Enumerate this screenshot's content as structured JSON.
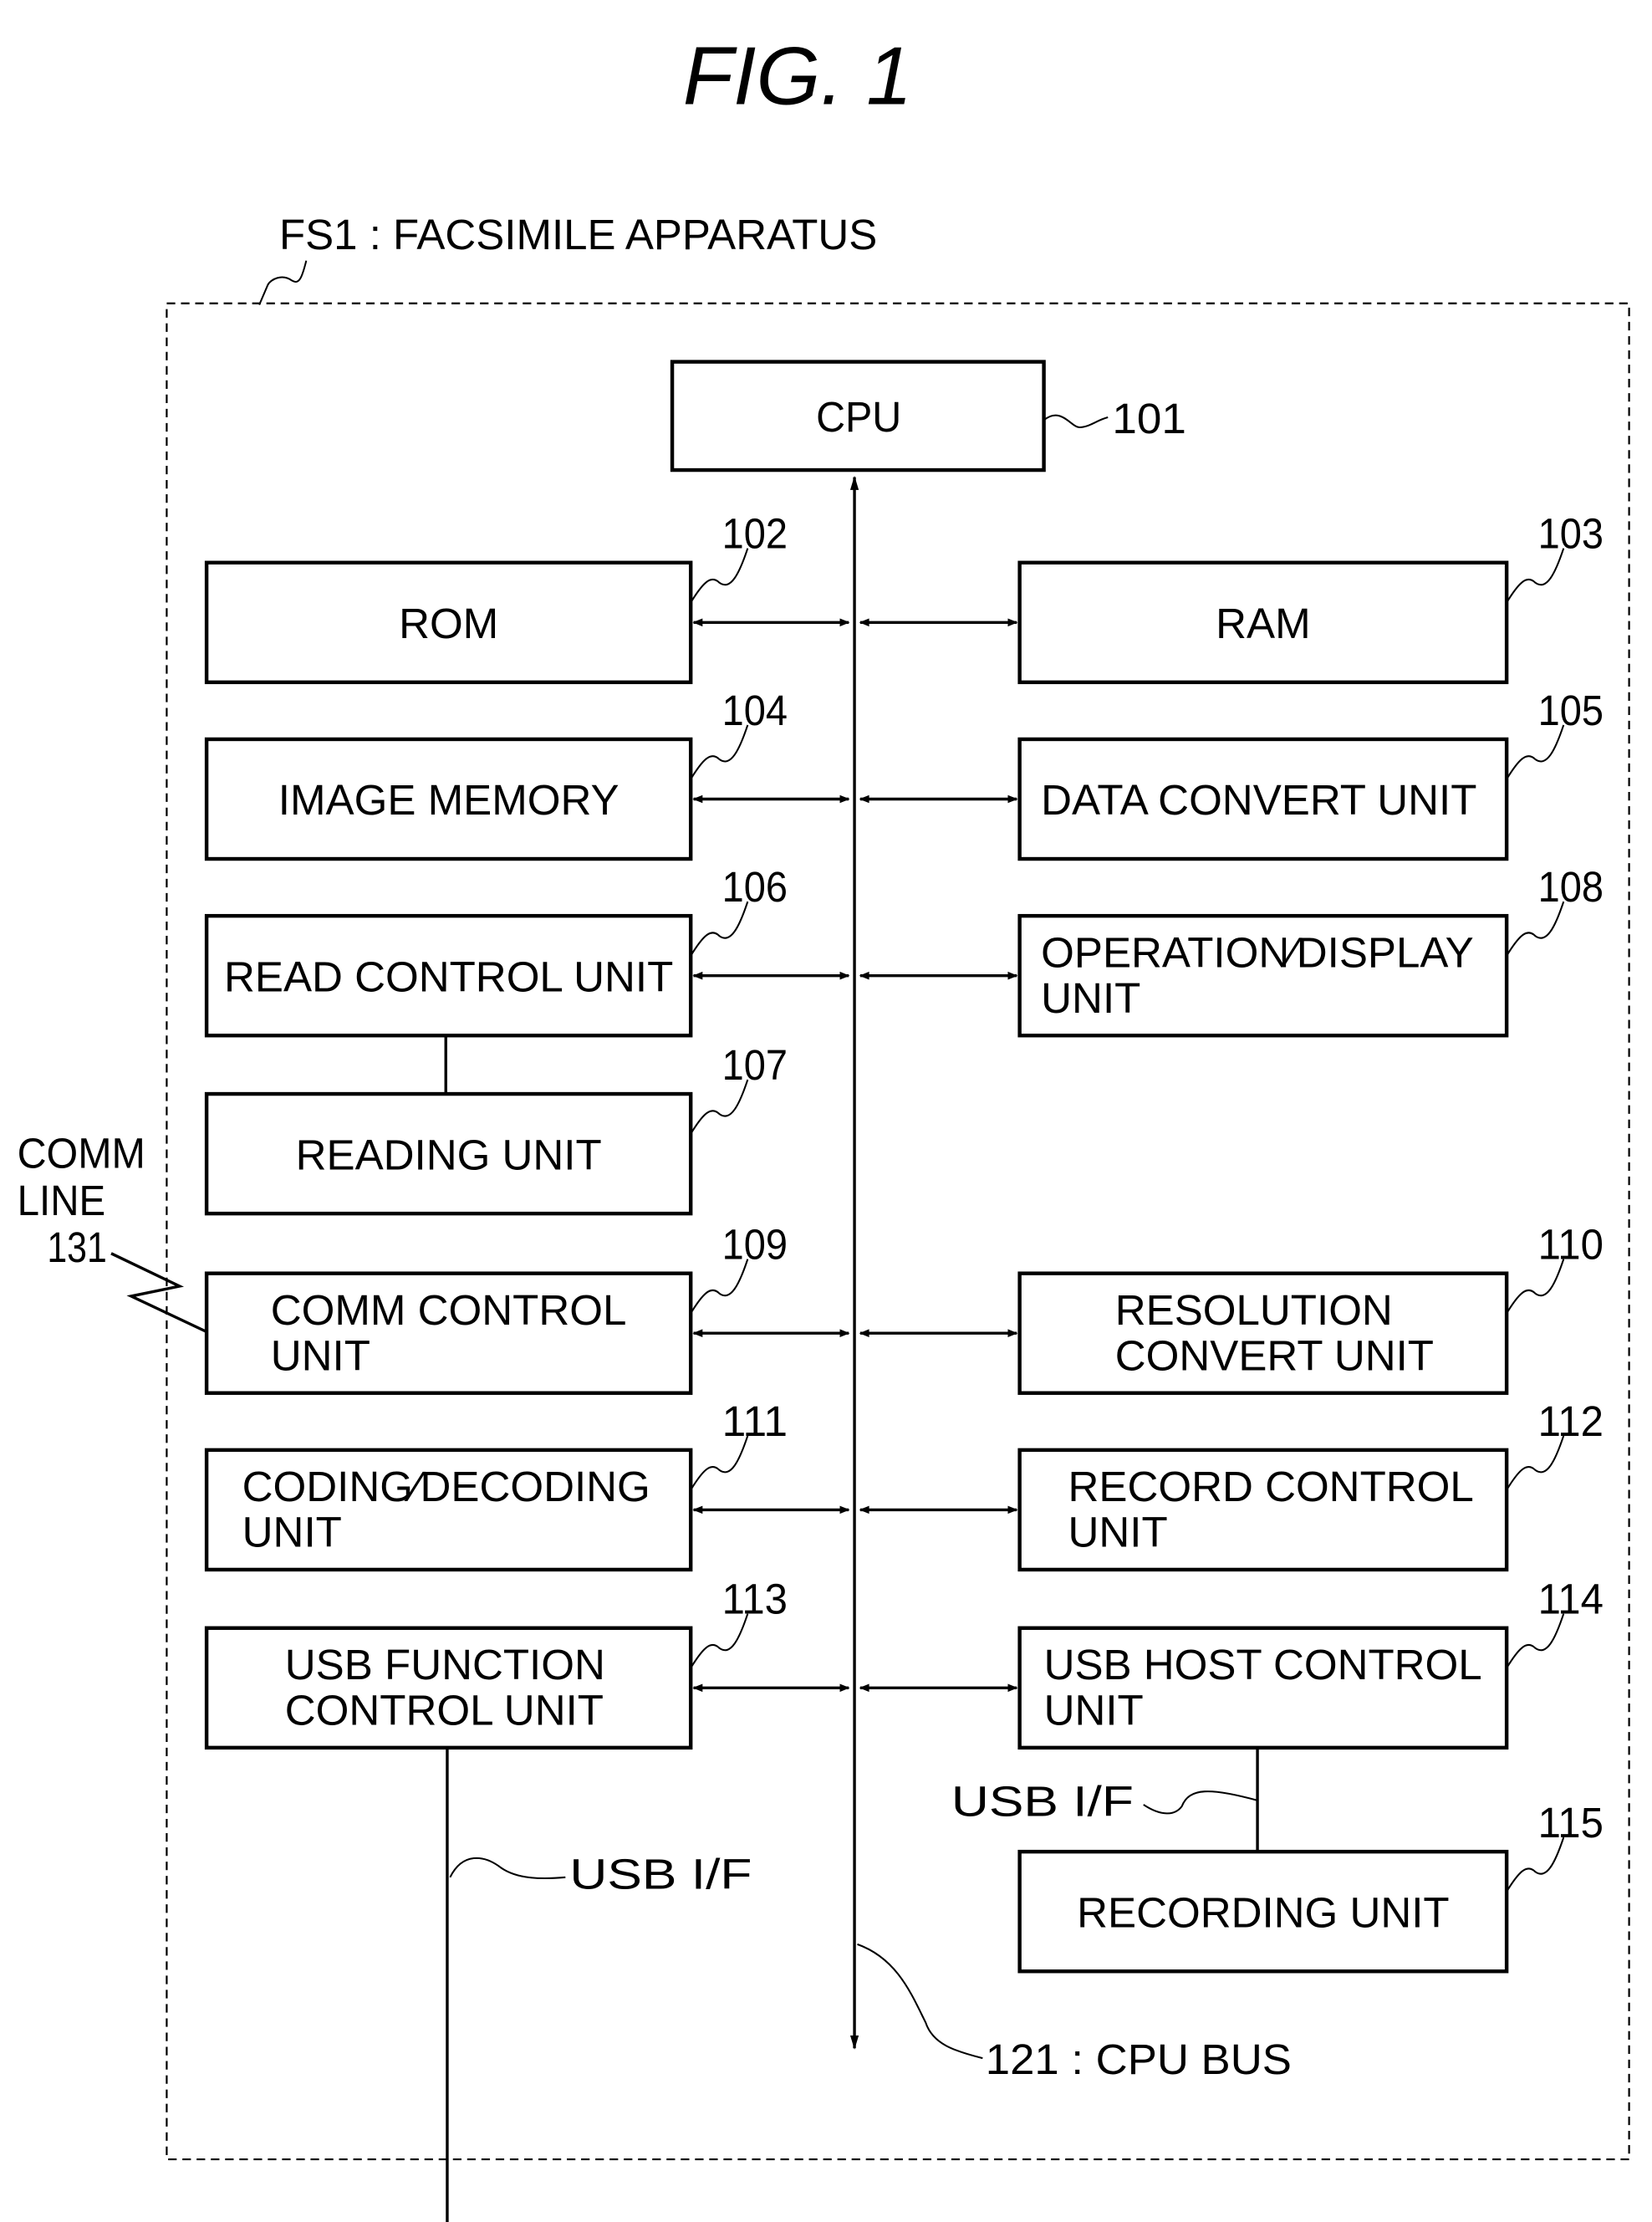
{
  "figure_title": "FIG. 1",
  "apparatus_label": "FS1 : FACSIMILE APPARATUS",
  "cpu": {
    "label": "CPU",
    "ref": "101"
  },
  "bus_label": "121 : CPU BUS",
  "comm_line": {
    "line1": "COMM",
    "line2": "LINE",
    "ref": "131"
  },
  "usb_if_left": "USB I/F",
  "usb_if_right": "USB I/F",
  "blocks": [
    {
      "id": "rom",
      "ref": "102",
      "lines": [
        "ROM"
      ],
      "side": "left",
      "row": 0
    },
    {
      "id": "ram",
      "ref": "103",
      "lines": [
        "RAM"
      ],
      "side": "right",
      "row": 0
    },
    {
      "id": "image-memory",
      "ref": "104",
      "lines": [
        "IMAGE  MEMORY"
      ],
      "side": "left",
      "row": 1
    },
    {
      "id": "data-convert-unit",
      "ref": "105",
      "lines": [
        "DATA  CONVERT  UNIT"
      ],
      "side": "right",
      "row": 1
    },
    {
      "id": "read-control-unit",
      "ref": "106",
      "lines": [
        "READ  CONTROL  UNIT"
      ],
      "side": "left",
      "row": 2
    },
    {
      "id": "operation-display-unit",
      "ref": "108",
      "lines": [
        "OPERATION∕DISPLAY",
        "UNIT"
      ],
      "side": "right",
      "row": 2
    },
    {
      "id": "reading-unit",
      "ref": "107",
      "lines": [
        "READING  UNIT"
      ],
      "side": "left",
      "row": 3
    },
    {
      "id": "comm-control-unit",
      "ref": "109",
      "lines": [
        "COMM  CONTROL",
        "UNIT"
      ],
      "side": "left",
      "row": 4
    },
    {
      "id": "resolution-convert-unit",
      "ref": "110",
      "lines": [
        "RESOLUTION",
        "CONVERT  UNIT"
      ],
      "side": "right",
      "row": 4
    },
    {
      "id": "coding-decoding-unit",
      "ref": "111",
      "lines": [
        "CODING∕DECODING",
        "UNIT"
      ],
      "side": "left",
      "row": 5
    },
    {
      "id": "record-control-unit",
      "ref": "112",
      "lines": [
        "RECORD  CONTROL",
        "UNIT"
      ],
      "side": "right",
      "row": 5
    },
    {
      "id": "usb-function-control-unit",
      "ref": "113",
      "lines": [
        "USB  FUNCTION",
        "CONTROL  UNIT"
      ],
      "side": "left",
      "row": 6
    },
    {
      "id": "usb-host-control-unit",
      "ref": "114",
      "lines": [
        "USB  HOST  CONTROL",
        "UNIT"
      ],
      "side": "right",
      "row": 6
    },
    {
      "id": "recording-unit",
      "ref": "115",
      "lines": [
        "RECORDING  UNIT"
      ],
      "side": "right",
      "row": 7
    }
  ]
}
